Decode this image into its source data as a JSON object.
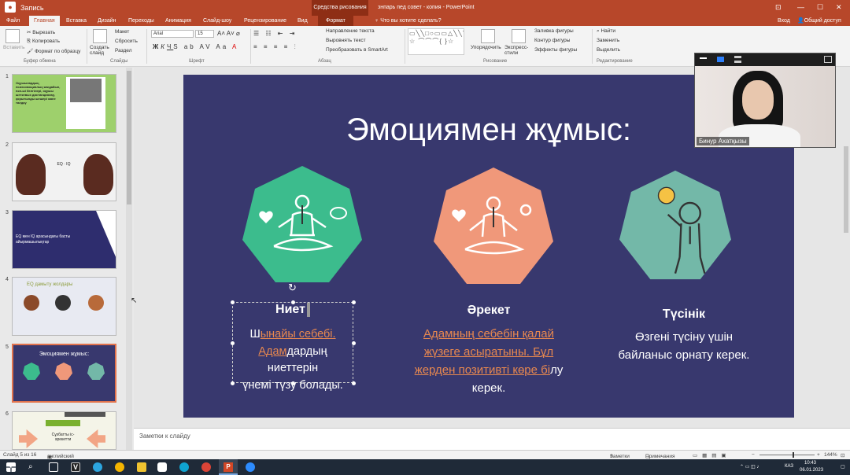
{
  "titlebar": {
    "recording": "Запись",
    "context_tab": "Средства рисования",
    "doc_title": "знпарь пед совет - копия - PowerPoint"
  },
  "tabs": {
    "file": "Файл",
    "home": "Главная",
    "insert": "Вставка",
    "design": "Дизайн",
    "transitions": "Переходы",
    "animations": "Анимация",
    "slideshow": "Слайд-шоу",
    "review": "Рецензирование",
    "view": "Вид",
    "format": "Формат",
    "tellme": "Что вы хотите сделать?",
    "login": "Вход",
    "share": "Общий доступ"
  },
  "ribbon": {
    "paste": "Вставить",
    "cut": "Вырезать",
    "copy": "Копировать",
    "format_painter": "Формат по образцу",
    "clipboard": "Буфер обмена",
    "new_slide": "Создать слайд",
    "layout": "Макет",
    "reset": "Сбросить",
    "section": "Раздел",
    "slides": "Слайды",
    "font_name": "Arial",
    "font_size": "15",
    "font_group": "Шрифт",
    "text_direction": "Направление текста",
    "align_text": "Выровнять текст",
    "smartart": "Преобразовать в SmartArt",
    "paragraph": "Абзац",
    "arrange": "Упорядочить",
    "quick_styles": "Экспресс-стили",
    "drawing": "Рисование",
    "fill": "Заливка фигуры",
    "outline": "Контур фигуры",
    "effects": "Эффекты фигуры",
    "find": "Найти",
    "replace": "Заменить",
    "select": "Выделить",
    "editing": "Редактирование"
  },
  "thumbnails": [
    {
      "num": "1",
      "text": "Оқушылардың психоэмоциялық жағдайын, пән-ші белгілері, оқушы шеткевых дистанциялау, қорытынды шешері жанe талдау"
    },
    {
      "num": "2",
      "text": "EQ · IQ"
    },
    {
      "num": "3",
      "text": "EQ мен IQ арасындағы басты айырмашылықтар"
    },
    {
      "num": "4",
      "text": "EQ дамыту жолдары"
    },
    {
      "num": "5",
      "text": "Эмоциямен жұмыс:"
    },
    {
      "num": "6",
      "text": "Сұхбатты іс-әрекетти"
    }
  ],
  "slide": {
    "title": "Эмоциямен жұмыс:",
    "col1": {
      "label": "Ниет",
      "line1a": "Ш",
      "line1b": "ынайы себебі.",
      "line2a": "Адам",
      "line2b": "дардың",
      "line3": "ниеттерін",
      "line4": "үнемі түзу болады."
    },
    "col2": {
      "label": "Әрекет",
      "line1": "Адамның себебін қалай",
      "line2": "жүзеге асыратыны. Бұл",
      "line3a": "жерден позитивті көре бі",
      "line3b": "лу",
      "line4": "керек."
    },
    "col3": {
      "label": "Түсінік",
      "line1": "Өзгені түсіну үшін",
      "line2": "байланыс орнату керек."
    },
    "colors": {
      "bg": "#38386e",
      "green": "#3cbc8d",
      "orange": "#f0987a",
      "teal": "#73b8a8"
    }
  },
  "camera": {
    "name": "Бинур Ахатқызы"
  },
  "notes": {
    "placeholder": "Заметки к слайду"
  },
  "status": {
    "slide": "Слайд 5 из 16",
    "lang": "английский (США)",
    "notes": "Заметки",
    "comments": "Примечания",
    "zoom": "144%"
  },
  "tray": {
    "lang": "КАЗ",
    "time": "10:43",
    "date": "06.01.2023"
  }
}
